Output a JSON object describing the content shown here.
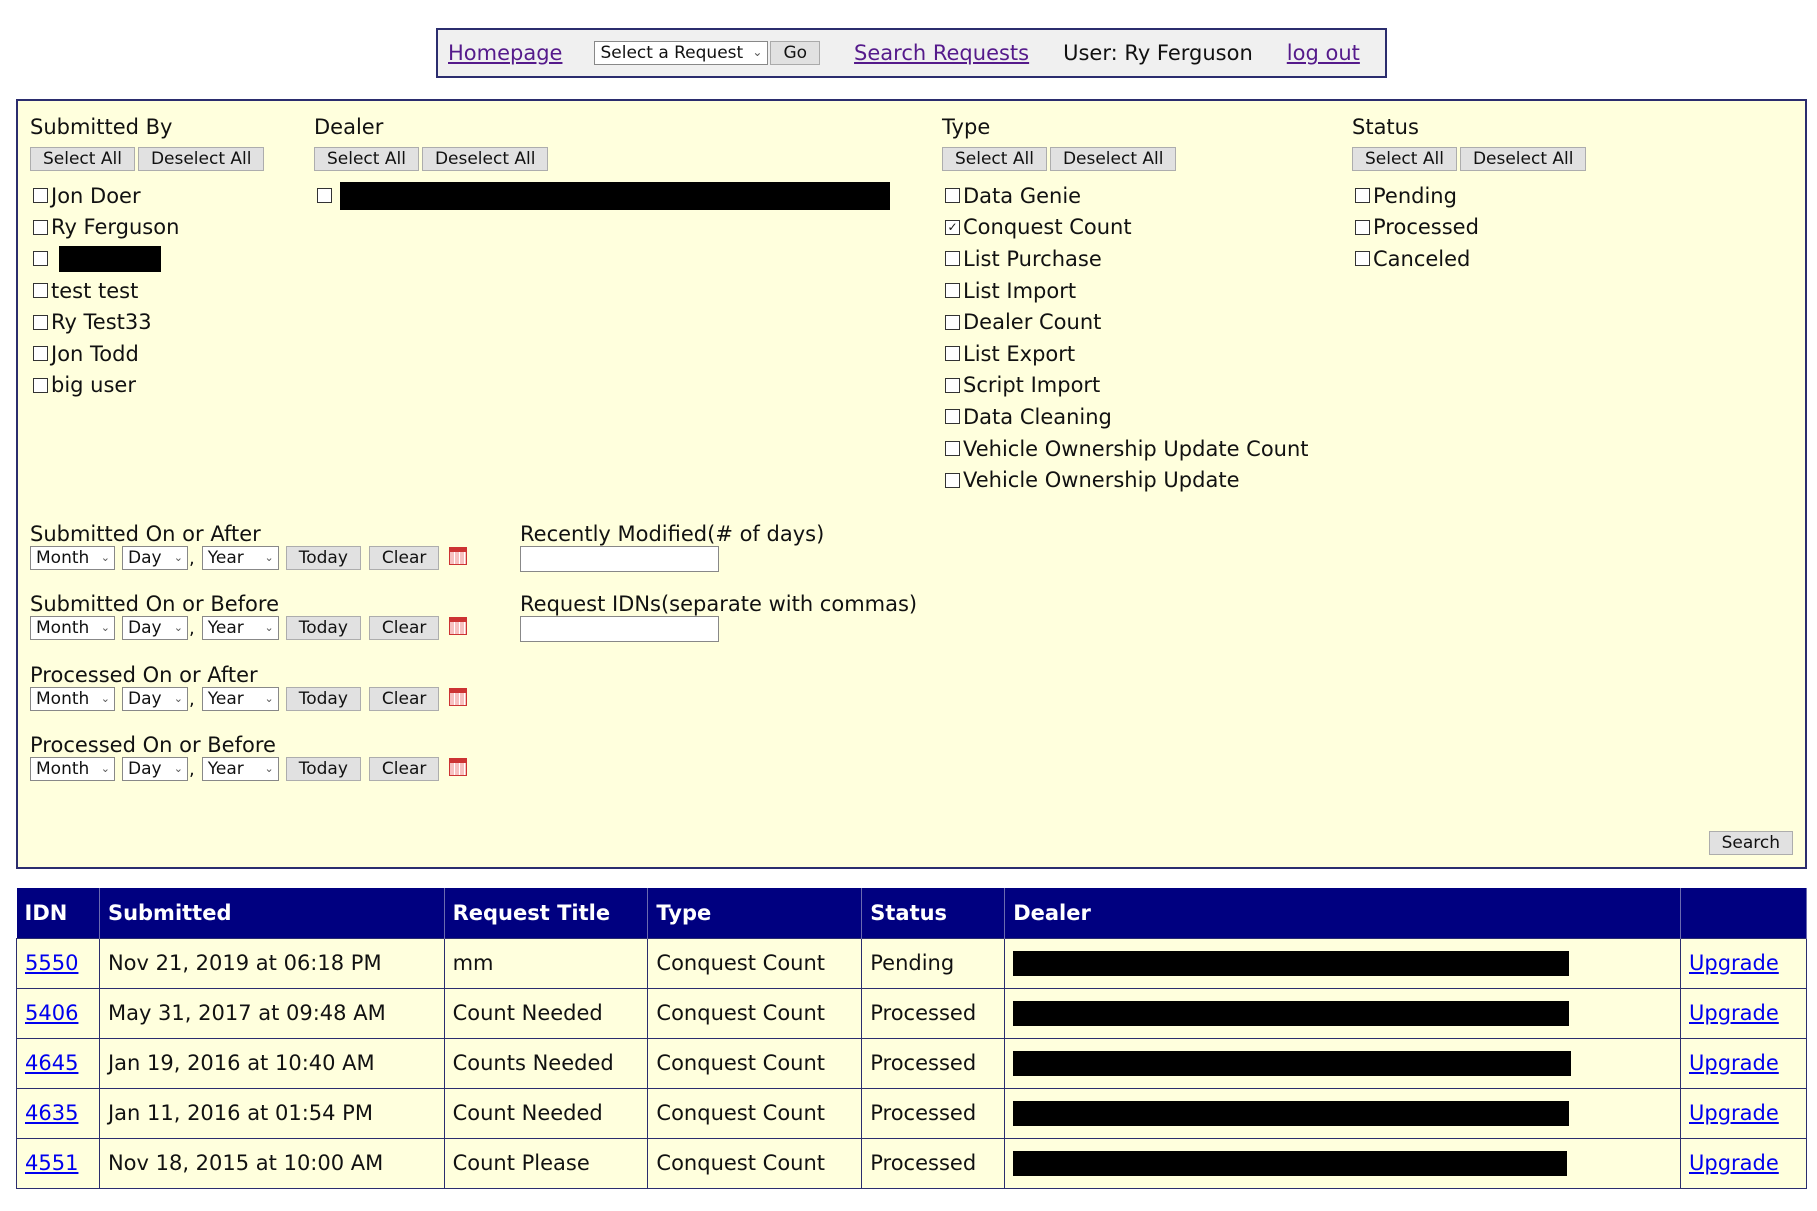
{
  "nav": {
    "home": "Homepage",
    "select_request": "Select a Request",
    "go": "Go",
    "search_requests": "Search Requests",
    "user": "User:  Ry Ferguson",
    "logout": "log out"
  },
  "filters": {
    "select_all": "Select All",
    "deselect_all": "Deselect All",
    "submitted_by": {
      "title": "Submitted By",
      "items": [
        {
          "label": "Jon Doer",
          "checked": false
        },
        {
          "label": "Ry Ferguson",
          "checked": false
        },
        {
          "label": "",
          "checked": false,
          "redacted": true
        },
        {
          "label": "test test",
          "checked": false
        },
        {
          "label": "Ry Test33",
          "checked": false
        },
        {
          "label": "Jon Todd",
          "checked": false
        },
        {
          "label": "big user",
          "checked": false
        }
      ]
    },
    "dealer": {
      "title": "Dealer"
    },
    "type": {
      "title": "Type",
      "items": [
        {
          "label": "Data Genie",
          "checked": false
        },
        {
          "label": "Conquest Count",
          "checked": true
        },
        {
          "label": "List Purchase",
          "checked": false
        },
        {
          "label": "List Import",
          "checked": false
        },
        {
          "label": "Dealer Count",
          "checked": false
        },
        {
          "label": "List Export",
          "checked": false
        },
        {
          "label": "Script Import",
          "checked": false
        },
        {
          "label": "Data Cleaning",
          "checked": false
        },
        {
          "label": "Vehicle Ownership Update Count",
          "checked": false
        },
        {
          "label": "Vehicle Ownership Update",
          "checked": false
        }
      ]
    },
    "status": {
      "title": "Status",
      "items": [
        {
          "label": "Pending",
          "checked": false
        },
        {
          "label": "Processed",
          "checked": false
        },
        {
          "label": "Canceled",
          "checked": false
        }
      ]
    },
    "dates": {
      "month": "Month",
      "day": "Day",
      "year": "Year",
      "today": "Today",
      "clear": "Clear",
      "submitted_after": "Submitted On or After",
      "submitted_before": "Submitted On or Before",
      "processed_after": "Processed On or After",
      "processed_before": "Processed On or Before"
    },
    "recently_modified": "Recently Modified(# of days)",
    "request_idns": "Request IDNs(separate with commas)",
    "search": "Search"
  },
  "table": {
    "headers": [
      "IDN",
      "Submitted",
      "Request Title",
      "Type",
      "Status",
      "Dealer",
      ""
    ],
    "upgrade": "Upgrade",
    "rows": [
      {
        "idn": "5550",
        "submitted": "Nov 21, 2019 at 06:18 PM",
        "title": "mm",
        "type": "Conquest Count",
        "status": "Pending"
      },
      {
        "idn": "5406",
        "submitted": "May 31, 2017 at 09:48 AM",
        "title": "Count Needed",
        "type": "Conquest Count",
        "status": "Processed"
      },
      {
        "idn": "4645",
        "submitted": "Jan 19, 2016 at 10:40 AM",
        "title": "Counts Needed",
        "type": "Conquest Count",
        "status": "Processed"
      },
      {
        "idn": "4635",
        "submitted": "Jan 11, 2016 at 01:54 PM",
        "title": "Count Needed",
        "type": "Conquest Count",
        "status": "Processed"
      },
      {
        "idn": "4551",
        "submitted": "Nov 18, 2015 at 10:00 AM",
        "title": "Count Please",
        "type": "Conquest Count",
        "status": "Processed"
      }
    ]
  }
}
